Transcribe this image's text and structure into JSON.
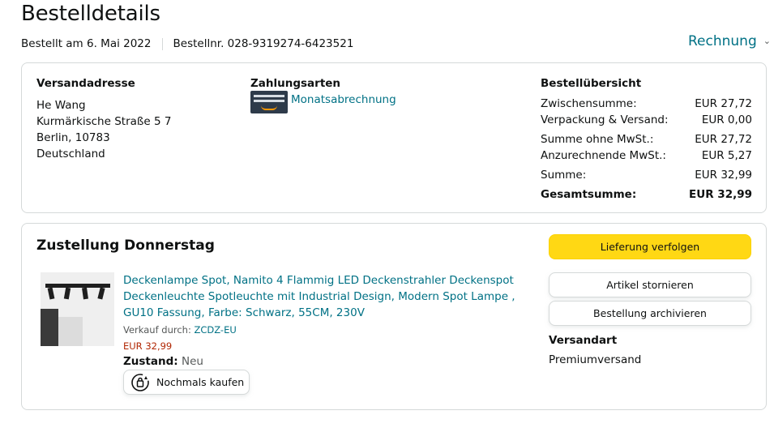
{
  "page": {
    "title": "Bestelldetails",
    "ordered_on": "Bestellt am 6. Mai 2022",
    "order_number": "Bestellnr. 028-9319274-6423521",
    "invoice_label": "Rechnung"
  },
  "shipping_address": {
    "heading": "Versandadresse",
    "name": "He Wang",
    "street": "Kurmärkische Straße 5 7",
    "city": "Berlin, 10783",
    "country": "Deutschland"
  },
  "payment": {
    "heading": "Zahlungsarten",
    "method": "Monatsabrechnung"
  },
  "summary": {
    "heading": "Bestellübersicht",
    "rows": [
      {
        "label": "Zwischensumme:",
        "value": "EUR 27,72"
      },
      {
        "label": "Verpackung & Versand:",
        "value": "EUR 0,00"
      },
      {
        "label": "Summe ohne MwSt.:",
        "value": "EUR 27,72"
      },
      {
        "label": "Anzurechnende MwSt.:",
        "value": "EUR 5,27"
      },
      {
        "label": "Summe:",
        "value": "EUR 32,99"
      },
      {
        "label": "Gesamtsumme:",
        "value": "EUR 32,99"
      }
    ]
  },
  "delivery": {
    "title": "Zustellung Donnerstag",
    "product_title": "Deckenlampe Spot, Namito 4 Flammig LED Deckenstrahler Deckenspot Deckenleuchte Spotleuchte mit Industrial Design, Modern Spot Lampe , GU10 Fassung, Farbe: Schwarz, 55CM, 230V",
    "seller_prefix": "Verkauf durch:",
    "seller": "ZCDZ-EU",
    "price": "EUR 32,99",
    "condition_label": "Zustand:",
    "condition_value": "Neu",
    "rebuy_label": "Nochmals kaufen",
    "track_label": "Lieferung verfolgen",
    "cancel_label": "Artikel stornieren",
    "archive_label": "Bestellung archivieren",
    "shipping_type_label": "Versandart",
    "shipping_type_value": "Premiumversand"
  },
  "colors": {
    "link": "#007185",
    "price": "#B12704",
    "primary_button": "#FFD814",
    "border": "#D5D9D9"
  }
}
